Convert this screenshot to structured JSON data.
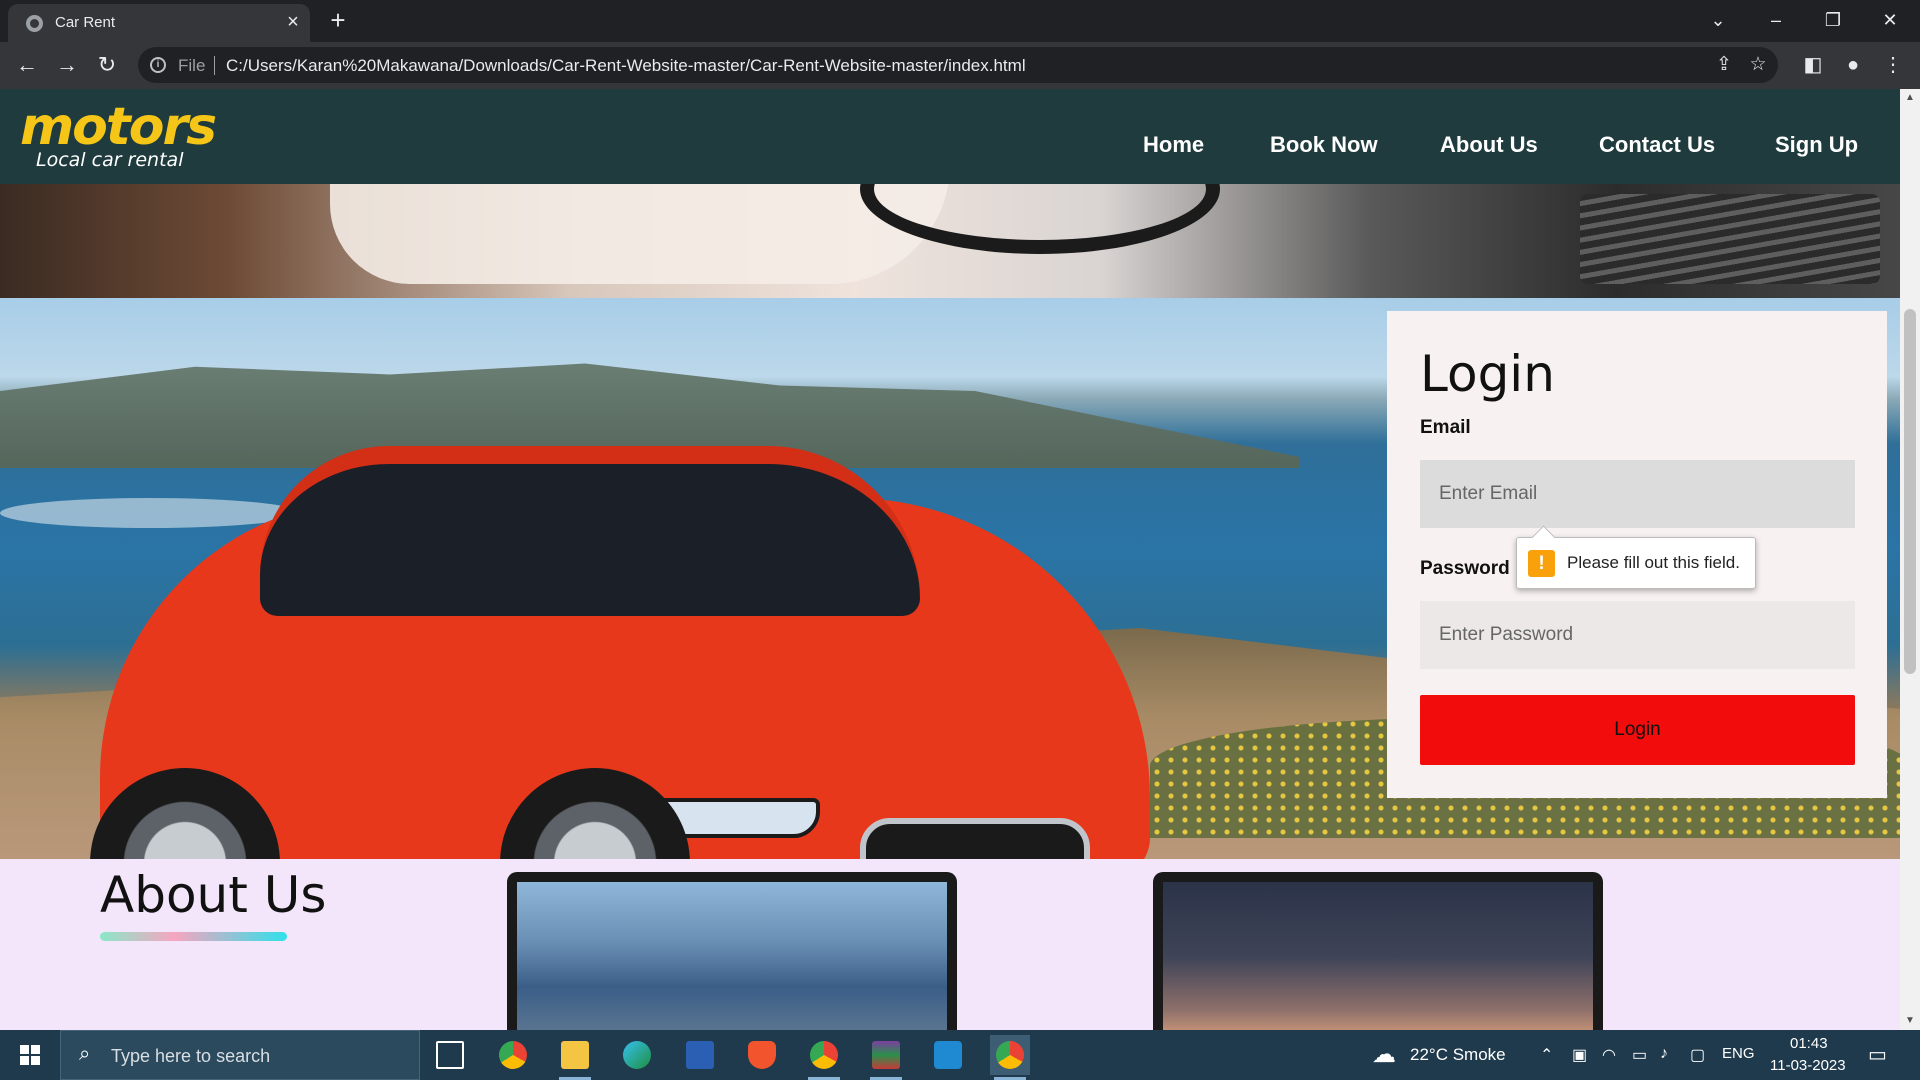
{
  "browser": {
    "tab_title": "Car Rent",
    "tab_close": "×",
    "new_tab": "+",
    "scheme": "File",
    "url": "C:/Users/Karan%20Makawana/Downloads/Car-Rent-Website-master/Car-Rent-Website-master/index.html"
  },
  "site": {
    "logo": "motors",
    "tagline": "Local car rental",
    "nav": [
      "Home",
      "Book Now",
      "About Us",
      "Contact Us",
      "Sign Up"
    ]
  },
  "login": {
    "title": "Login",
    "email_label": "Email",
    "email_placeholder": "Enter Email",
    "password_label": "Password",
    "password_placeholder": "Enter Password",
    "button": "Login",
    "validation_message": "Please fill out this field."
  },
  "about": {
    "title": "About Us"
  },
  "taskbar": {
    "search_placeholder": "Type here to search",
    "weather": "22°C  Smoke",
    "language": "ENG",
    "time": "01:43",
    "date": "11-03-2023"
  },
  "colors": {
    "header_bg": "#1f3b3e",
    "logo": "#f5c518",
    "login_button": "#f30c0c",
    "about_bg": "#f3e6fb"
  }
}
